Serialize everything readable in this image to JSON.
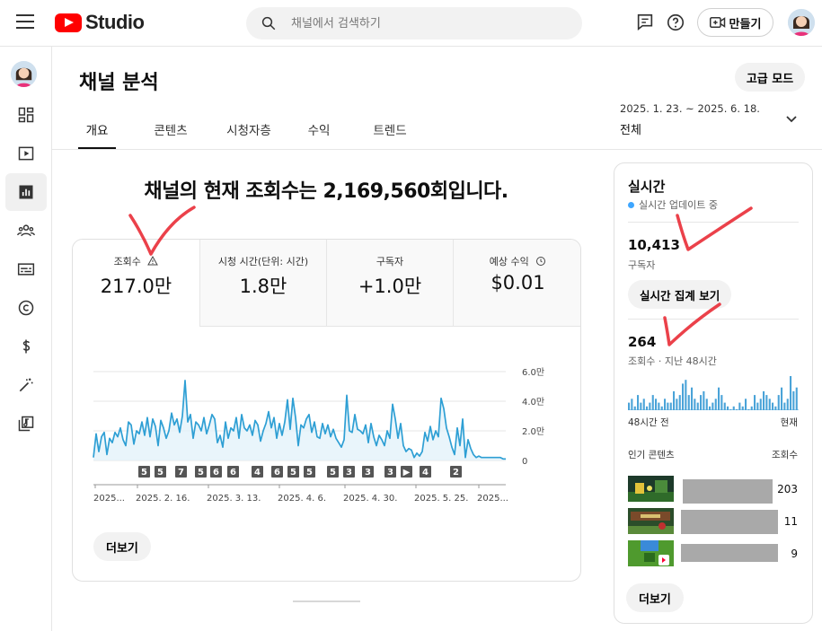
{
  "app": {
    "logo_text": "Studio"
  },
  "topbar": {
    "search_placeholder": "채널에서 검색하기",
    "create_label": "만들기"
  },
  "page": {
    "title": "채널 분석",
    "advanced_mode_label": "고급 모드",
    "tabs": [
      {
        "label": "개요",
        "active": true
      },
      {
        "label": "콘텐츠",
        "active": false
      },
      {
        "label": "시청자층",
        "active": false
      },
      {
        "label": "수익",
        "active": false
      },
      {
        "label": "트렌드",
        "active": false
      }
    ],
    "date_range": "2025. 1. 23. ~ 2025. 6. 18.",
    "date_range_sub": "전체",
    "headline": "채널의 현재 조회수는 2,169,560회입니다."
  },
  "metrics": [
    {
      "label": "조회수",
      "value": "217.0만",
      "active": true,
      "icon": "warning-icon"
    },
    {
      "label": "시청 시간(단위: 시간)",
      "value": "1.8만",
      "active": false
    },
    {
      "label": "구독자",
      "value": "+1.0만",
      "active": false
    },
    {
      "label": "예상 수익",
      "value": "$0.01",
      "active": false,
      "icon": "clock-icon"
    }
  ],
  "chart_data": {
    "type": "area",
    "ylim": [
      0,
      6.0
    ],
    "y_tick_labels": [
      "6.0만",
      "4.0만",
      "2.0만",
      "0"
    ],
    "y_tick_values": [
      6.0,
      4.0,
      2.0,
      0
    ],
    "x_tick_labels": [
      "2025...",
      "2025. 2. 16.",
      "2025. 3. 13.",
      "2025. 4. 6.",
      "2025. 4. 30.",
      "2025. 5. 25.",
      "2025..."
    ],
    "series": [
      {
        "color": "#2e9fd4",
        "values": [
          0.2,
          1.8,
          0.6,
          1.6,
          1.9,
          0.4,
          1.5,
          1.2,
          1.9,
          1.6,
          2.2,
          1.4,
          1.0,
          2.6,
          2.4,
          1.1,
          2.0,
          1.8,
          2.6,
          1.7,
          2.9,
          1.6,
          2.8,
          2.3,
          1.0,
          2.7,
          2.2,
          1.5,
          2.0,
          3.2,
          2.4,
          2.8,
          1.9,
          3.0,
          5.4,
          2.6,
          3.1,
          1.5,
          2.6,
          2.4,
          2.0,
          2.9,
          1.8,
          2.4,
          3.1,
          2.8,
          1.2,
          1.7,
          0.9,
          2.6,
          1.5,
          2.2,
          2.0,
          2.9,
          1.5,
          3.1,
          2.2,
          2.0,
          2.4,
          1.7,
          2.7,
          2.4,
          1.3,
          2.0,
          2.5,
          3.3,
          2.2,
          2.9,
          1.5,
          2.5,
          1.7,
          2.6,
          4.1,
          2.1,
          4.2,
          2.9,
          1.0,
          2.4,
          2.2,
          2.8,
          3.1,
          1.9,
          2.6,
          1.6,
          1.5,
          2.5,
          1.8,
          2.4,
          1.6,
          2.1,
          1.5,
          1.2,
          0.9,
          1.4,
          4.4,
          2.0,
          1.9,
          3.1,
          2.1,
          2.0,
          1.8,
          2.4,
          1.2,
          2.5,
          1.6,
          1.0,
          1.7,
          1.4,
          1.0,
          2.0,
          1.5,
          3.8,
          2.8,
          1.5,
          2.5,
          1.0,
          0.6,
          0.8,
          0.7,
          0.2,
          0.5,
          0.3,
          0.6,
          1.9,
          1.3,
          2.3,
          1.4,
          2.0,
          1.6,
          4.2,
          3.5,
          2.2,
          1.6,
          0.9,
          0.4,
          2.2,
          1.0,
          2.8,
          0.2,
          1.4,
          0.8,
          0.4,
          0.2,
          0.3,
          0.2,
          0.2,
          0.2,
          0.2,
          0.2,
          0.2,
          0.2,
          0.2,
          0.1,
          0.1
        ]
      }
    ],
    "markers": [
      {
        "label": "5",
        "dark": true
      },
      {
        "label": "5",
        "dark": true
      },
      {
        "label": "7",
        "dark": true
      },
      {
        "label": "5",
        "dark": true
      },
      {
        "label": "6",
        "dark": true
      },
      {
        "label": "6",
        "dark": true
      },
      {
        "label": "4",
        "dark": true
      },
      {
        "label": "6",
        "dark": true
      },
      {
        "label": "5",
        "dark": true
      },
      {
        "label": "5",
        "dark": true
      },
      {
        "label": "5",
        "dark": true
      },
      {
        "label": "3",
        "dark": true
      },
      {
        "label": "3",
        "dark": true
      },
      {
        "label": "3",
        "dark": true
      },
      {
        "label": "▶",
        "dark": true
      },
      {
        "label": "4",
        "dark": true
      },
      {
        "label": "2",
        "dark": true
      }
    ],
    "grid": true
  },
  "chart_more_label": "더보기",
  "realtime": {
    "title": "실시간",
    "live_text": "실시간 업데이트 중",
    "subscribers": "10,413",
    "subscribers_label": "구독자",
    "live_count_button": "실시간 집계 보기",
    "views": "264",
    "views_label": "조회수 · 지난 48시간",
    "bars": [
      2,
      3,
      1,
      4,
      2,
      3,
      1,
      2,
      4,
      3,
      2,
      1,
      3,
      2,
      2,
      5,
      3,
      4,
      7,
      8,
      4,
      6,
      3,
      2,
      4,
      5,
      3,
      1,
      2,
      3,
      6,
      4,
      2,
      1,
      0,
      1,
      0,
      2,
      1,
      3,
      0,
      1,
      4,
      2,
      3,
      5,
      4,
      3,
      2,
      1,
      4,
      6,
      2,
      3,
      9,
      5,
      6
    ],
    "axis_start": "48시간 전",
    "axis_end": "현재",
    "top_content_label": "인기 콘텐츠",
    "top_content_metric": "조회수",
    "rows": [
      {
        "count": "203"
      },
      {
        "count": "11"
      },
      {
        "count": "9"
      }
    ],
    "more_label": "더보기"
  }
}
